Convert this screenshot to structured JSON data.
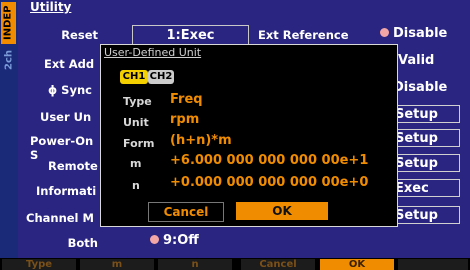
{
  "side": {
    "indep_label": "INDEP",
    "channel_label": "2ch"
  },
  "title": "Utility",
  "rows": {
    "reset": {
      "label": "Reset",
      "value": "1:Exec"
    },
    "ext_add": {
      "label": "Ext Add"
    },
    "phi_sync": {
      "label": "ϕ Sync"
    },
    "user_un": {
      "label": "User Un"
    },
    "power_on": {
      "label": "Power-On S"
    },
    "remote": {
      "label": "Remote"
    },
    "information": {
      "label": "Informati"
    },
    "channel_m": {
      "label": "Channel M"
    },
    "both": {
      "label": "Both",
      "value": "9:Off"
    }
  },
  "right": {
    "ext_ref_label": "Ext Reference",
    "ext_ref_value": "Disable",
    "valid": "Valid",
    "sync_value": "Disable",
    "setup1": "Setup",
    "setup2": "Setup",
    "setup3": "Setup",
    "exec": "Exec",
    "setup4": "Setup"
  },
  "dialog": {
    "title": "User-Defined Unit",
    "tabs": [
      "CH1",
      "CH2"
    ],
    "fields": [
      {
        "key": "Type",
        "value": "Freq"
      },
      {
        "key": "Unit",
        "value": "rpm"
      },
      {
        "key": "Form",
        "value": "(h+n)*m"
      },
      {
        "key": "m",
        "value": "+6.000 000 000 000 00e+1"
      },
      {
        "key": "n",
        "value": "+0.000 000 000 000 00e+0"
      }
    ],
    "cancel": "Cancel",
    "ok": "OK"
  },
  "softkeys": [
    {
      "label": "Type",
      "active": false
    },
    {
      "label": "m",
      "active": false
    },
    {
      "label": "n",
      "active": false
    },
    {
      "label": "Cancel",
      "active": false
    },
    {
      "label": "OK",
      "active": false
    },
    {
      "label": "",
      "active": false
    }
  ],
  "colors": {
    "accent": "#f08c00",
    "background": "#2a2580",
    "indicator": "#f2a6a6"
  }
}
